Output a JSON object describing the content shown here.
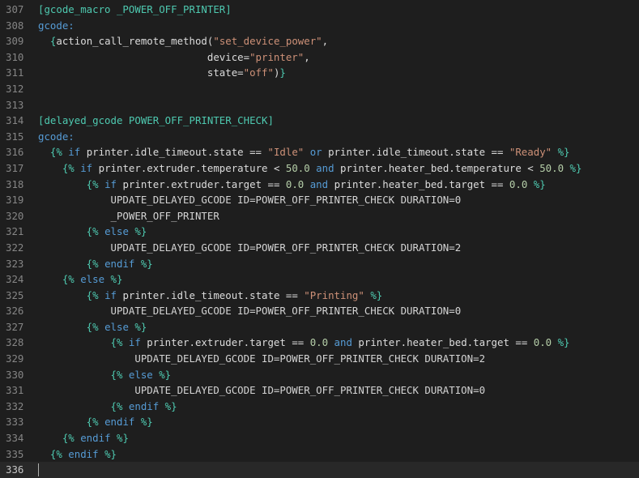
{
  "editor": {
    "lines": [
      {
        "n": "307",
        "tokens": [
          {
            "t": "[gcode_macro _POWER_OFF_PRINTER]",
            "c": "section"
          }
        ]
      },
      {
        "n": "308",
        "tokens": [
          {
            "t": "gcode:",
            "c": "key"
          }
        ]
      },
      {
        "n": "309",
        "tokens": [
          {
            "t": "  {",
            "c": "brace"
          },
          {
            "t": "action_call_remote_method(",
            "c": "text"
          },
          {
            "t": "\"set_device_power\"",
            "c": "str"
          },
          {
            "t": ",",
            "c": "text"
          }
        ]
      },
      {
        "n": "310",
        "tokens": [
          {
            "t": "                            device=",
            "c": "text"
          },
          {
            "t": "\"printer\"",
            "c": "str"
          },
          {
            "t": ",",
            "c": "text"
          }
        ]
      },
      {
        "n": "311",
        "tokens": [
          {
            "t": "                            state=",
            "c": "text"
          },
          {
            "t": "\"off\"",
            "c": "str"
          },
          {
            "t": ")",
            "c": "text"
          },
          {
            "t": "}",
            "c": "brace"
          }
        ]
      },
      {
        "n": "312",
        "tokens": []
      },
      {
        "n": "313",
        "tokens": []
      },
      {
        "n": "314",
        "tokens": [
          {
            "t": "[delayed_gcode POWER_OFF_PRINTER_CHECK]",
            "c": "section"
          }
        ]
      },
      {
        "n": "315",
        "tokens": [
          {
            "t": "gcode:",
            "c": "key"
          }
        ]
      },
      {
        "n": "316",
        "tokens": [
          {
            "t": "  {%",
            "c": "brace"
          },
          {
            "t": " if ",
            "c": "kw"
          },
          {
            "t": "printer.idle_timeout.state == ",
            "c": "text"
          },
          {
            "t": "\"Idle\"",
            "c": "str"
          },
          {
            "t": " or ",
            "c": "kw"
          },
          {
            "t": "printer.idle_timeout.state == ",
            "c": "text"
          },
          {
            "t": "\"Ready\"",
            "c": "str"
          },
          {
            "t": " %}",
            "c": "brace"
          }
        ]
      },
      {
        "n": "317",
        "tokens": [
          {
            "t": "    {%",
            "c": "brace"
          },
          {
            "t": " if ",
            "c": "kw"
          },
          {
            "t": "printer.extruder.temperature < ",
            "c": "text"
          },
          {
            "t": "50.0",
            "c": "num"
          },
          {
            "t": " and ",
            "c": "kw"
          },
          {
            "t": "printer.heater_bed.temperature < ",
            "c": "text"
          },
          {
            "t": "50.0",
            "c": "num"
          },
          {
            "t": " %}",
            "c": "brace"
          }
        ]
      },
      {
        "n": "318",
        "tokens": [
          {
            "t": "        {%",
            "c": "brace"
          },
          {
            "t": " if ",
            "c": "kw"
          },
          {
            "t": "printer.extruder.target == ",
            "c": "text"
          },
          {
            "t": "0.0",
            "c": "num"
          },
          {
            "t": " and ",
            "c": "kw"
          },
          {
            "t": "printer.heater_bed.target == ",
            "c": "text"
          },
          {
            "t": "0.0",
            "c": "num"
          },
          {
            "t": " %}",
            "c": "brace"
          }
        ]
      },
      {
        "n": "319",
        "tokens": [
          {
            "t": "            UPDATE_DELAYED_GCODE ID=POWER_OFF_PRINTER_CHECK DURATION=0",
            "c": "plain"
          }
        ]
      },
      {
        "n": "320",
        "tokens": [
          {
            "t": "            _POWER_OFF_PRINTER",
            "c": "plain"
          }
        ]
      },
      {
        "n": "321",
        "tokens": [
          {
            "t": "        {%",
            "c": "brace"
          },
          {
            "t": " else ",
            "c": "kw"
          },
          {
            "t": "%}",
            "c": "brace"
          }
        ]
      },
      {
        "n": "322",
        "tokens": [
          {
            "t": "            UPDATE_DELAYED_GCODE ID=POWER_OFF_PRINTER_CHECK DURATION=2",
            "c": "plain"
          }
        ]
      },
      {
        "n": "323",
        "tokens": [
          {
            "t": "        {%",
            "c": "brace"
          },
          {
            "t": " endif ",
            "c": "kw"
          },
          {
            "t": "%}",
            "c": "brace"
          }
        ]
      },
      {
        "n": "324",
        "tokens": [
          {
            "t": "    {%",
            "c": "brace"
          },
          {
            "t": " else ",
            "c": "kw"
          },
          {
            "t": "%}",
            "c": "brace"
          }
        ]
      },
      {
        "n": "325",
        "tokens": [
          {
            "t": "        {%",
            "c": "brace"
          },
          {
            "t": " if ",
            "c": "kw"
          },
          {
            "t": "printer.idle_timeout.state == ",
            "c": "text"
          },
          {
            "t": "\"Printing\"",
            "c": "str"
          },
          {
            "t": " %}",
            "c": "brace"
          }
        ]
      },
      {
        "n": "326",
        "tokens": [
          {
            "t": "            UPDATE_DELAYED_GCODE ID=POWER_OFF_PRINTER_CHECK DURATION=0",
            "c": "plain"
          }
        ]
      },
      {
        "n": "327",
        "tokens": [
          {
            "t": "        {%",
            "c": "brace"
          },
          {
            "t": " else ",
            "c": "kw"
          },
          {
            "t": "%}",
            "c": "brace"
          }
        ]
      },
      {
        "n": "328",
        "tokens": [
          {
            "t": "            {%",
            "c": "brace"
          },
          {
            "t": " if ",
            "c": "kw"
          },
          {
            "t": "printer.extruder.target == ",
            "c": "text"
          },
          {
            "t": "0.0",
            "c": "num"
          },
          {
            "t": " and ",
            "c": "kw"
          },
          {
            "t": "printer.heater_bed.target == ",
            "c": "text"
          },
          {
            "t": "0.0",
            "c": "num"
          },
          {
            "t": " %}",
            "c": "brace"
          }
        ]
      },
      {
        "n": "329",
        "tokens": [
          {
            "t": "                UPDATE_DELAYED_GCODE ID=POWER_OFF_PRINTER_CHECK DURATION=2",
            "c": "plain"
          }
        ]
      },
      {
        "n": "330",
        "tokens": [
          {
            "t": "            {%",
            "c": "brace"
          },
          {
            "t": " else ",
            "c": "kw"
          },
          {
            "t": "%}",
            "c": "brace"
          }
        ]
      },
      {
        "n": "331",
        "tokens": [
          {
            "t": "                UPDATE_DELAYED_GCODE ID=POWER_OFF_PRINTER_CHECK DURATION=0",
            "c": "plain"
          }
        ]
      },
      {
        "n": "332",
        "tokens": [
          {
            "t": "            {%",
            "c": "brace"
          },
          {
            "t": " endif ",
            "c": "kw"
          },
          {
            "t": "%}",
            "c": "brace"
          }
        ]
      },
      {
        "n": "333",
        "tokens": [
          {
            "t": "        {%",
            "c": "brace"
          },
          {
            "t": " endif ",
            "c": "kw"
          },
          {
            "t": "%}",
            "c": "brace"
          }
        ]
      },
      {
        "n": "334",
        "tokens": [
          {
            "t": "    {%",
            "c": "brace"
          },
          {
            "t": " endif ",
            "c": "kw"
          },
          {
            "t": "%}",
            "c": "brace"
          }
        ]
      },
      {
        "n": "335",
        "tokens": [
          {
            "t": "  {%",
            "c": "brace"
          },
          {
            "t": " endif ",
            "c": "kw"
          },
          {
            "t": "%}",
            "c": "brace"
          }
        ]
      },
      {
        "n": "336",
        "tokens": [],
        "current": true
      }
    ]
  }
}
